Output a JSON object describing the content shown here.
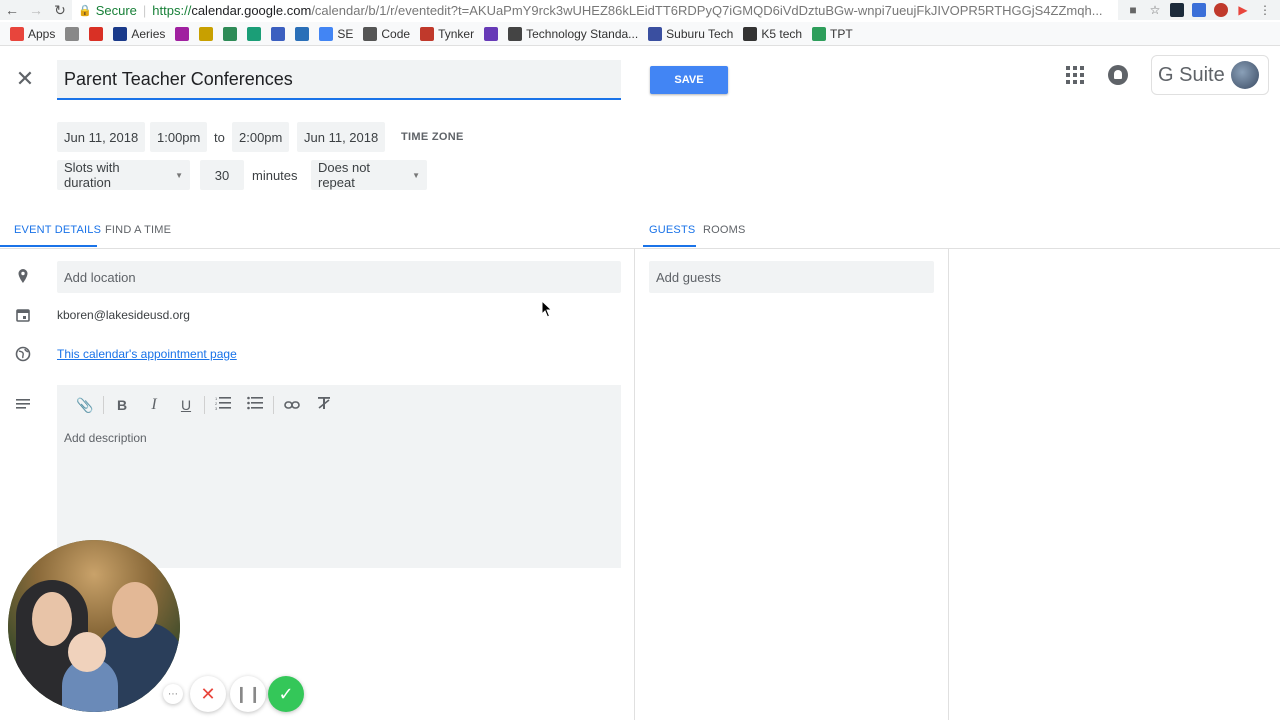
{
  "browser": {
    "secure_label": "Secure",
    "url_scheme": "https://",
    "url_host": "calendar.google.com",
    "url_path": "/calendar/b/1/r/eventedit?t=AKUaPmY9rck3wUHEZ86kLEidTT6RDPyQ7iGMQD6iVdDztuBGw-wnpi7ueujFkJIVOPR5RTHGGjS4ZZmqh..."
  },
  "bookmarks": [
    {
      "label": "Apps",
      "icon": "apps-grid-icon",
      "color": "#e8453c"
    },
    {
      "label": "",
      "icon": "rl-icon",
      "color": "#888888"
    },
    {
      "label": "",
      "icon": "gmail-icon",
      "color": "#d93025"
    },
    {
      "label": "Aeries",
      "icon": "aeries-icon",
      "color": "#1a3a8a"
    },
    {
      "label": "",
      "icon": "p-icon",
      "color": "#a020a0"
    },
    {
      "label": "",
      "icon": "yellow-icon",
      "color": "#c8a000"
    },
    {
      "label": "",
      "icon": "green-icon",
      "color": "#2e8b57"
    },
    {
      "label": "",
      "icon": "teal-icon",
      "color": "#1b9e77"
    },
    {
      "label": "",
      "icon": "c-icon",
      "color": "#3b5fc0"
    },
    {
      "label": "",
      "icon": "mountain-icon",
      "color": "#2a6fb8"
    },
    {
      "label": "SE",
      "icon": "se-icon",
      "color": "#4285f4"
    },
    {
      "label": "Code",
      "icon": "code-icon",
      "color": "#555555"
    },
    {
      "label": "Tynker",
      "icon": "tynker-icon",
      "color": "#c0392b"
    },
    {
      "label": "",
      "icon": "forms-icon",
      "color": "#673ab7"
    },
    {
      "label": "Technology Standa...",
      "icon": "cde-icon",
      "color": "#444444"
    },
    {
      "label": "Suburu Tech",
      "icon": "suburu-icon",
      "color": "#3a4fa0"
    },
    {
      "label": "K5 tech",
      "icon": "k5-icon",
      "color": "#333333"
    },
    {
      "label": "TPT",
      "icon": "tpt-icon",
      "color": "#2e9e5b"
    }
  ],
  "header": {
    "title": "Parent Teacher Conferences",
    "save_label": "SAVE",
    "brand": "G Suite"
  },
  "datetime": {
    "start_date": "Jun 11, 2018",
    "start_time": "1:00pm",
    "to_label": "to",
    "end_time": "2:00pm",
    "end_date": "Jun 11, 2018",
    "timezone_label": "TIME ZONE",
    "slot_mode": "Slots with duration",
    "duration": "30",
    "duration_unit": "minutes",
    "repeat": "Does not repeat"
  },
  "tabs": {
    "left": [
      {
        "label": "EVENT DETAILS",
        "active": true
      },
      {
        "label": "FIND A TIME",
        "active": false
      }
    ],
    "right": [
      {
        "label": "GUESTS",
        "active": true
      },
      {
        "label": "ROOMS",
        "active": false
      }
    ]
  },
  "details": {
    "location_placeholder": "Add location",
    "calendar_owner": "kboren@lakesideusd.org",
    "appointment_link": "This calendar's appointment page",
    "description_placeholder": "Add description"
  },
  "guests": {
    "placeholder": "Add guests"
  },
  "colors": {
    "accent": "#1a73e8",
    "save_button": "#4285f4",
    "field_bg": "#f1f3f4",
    "confirm_green": "#34c759",
    "cancel_red": "#e8453c"
  }
}
